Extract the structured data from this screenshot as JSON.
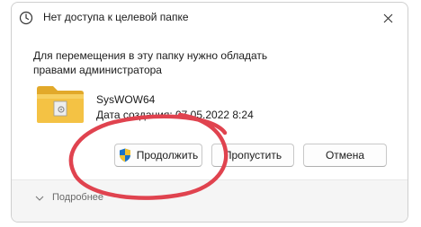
{
  "window": {
    "title": "Нет доступа к целевой папке",
    "title_icon": "clock-icon",
    "close_icon": "close-icon"
  },
  "message": "Для перемещения в эту папку нужно обладать правами администратора",
  "file": {
    "icon": "folder-icon",
    "name": "SysWOW64",
    "date": "Дата создания: 07.05.2022 8:24"
  },
  "buttons": {
    "continue_label": "Продолжить",
    "continue_icon": "uac-shield-icon",
    "skip_label": "Пропустить",
    "cancel_label": "Отмена"
  },
  "footer": {
    "details_label": "Подробнее",
    "details_icon": "chevron-down-icon"
  },
  "colors": {
    "annotation": "#e0434f",
    "folder": "#f4c244",
    "shield_blue": "#1a73c9",
    "shield_yellow": "#f2c230"
  }
}
